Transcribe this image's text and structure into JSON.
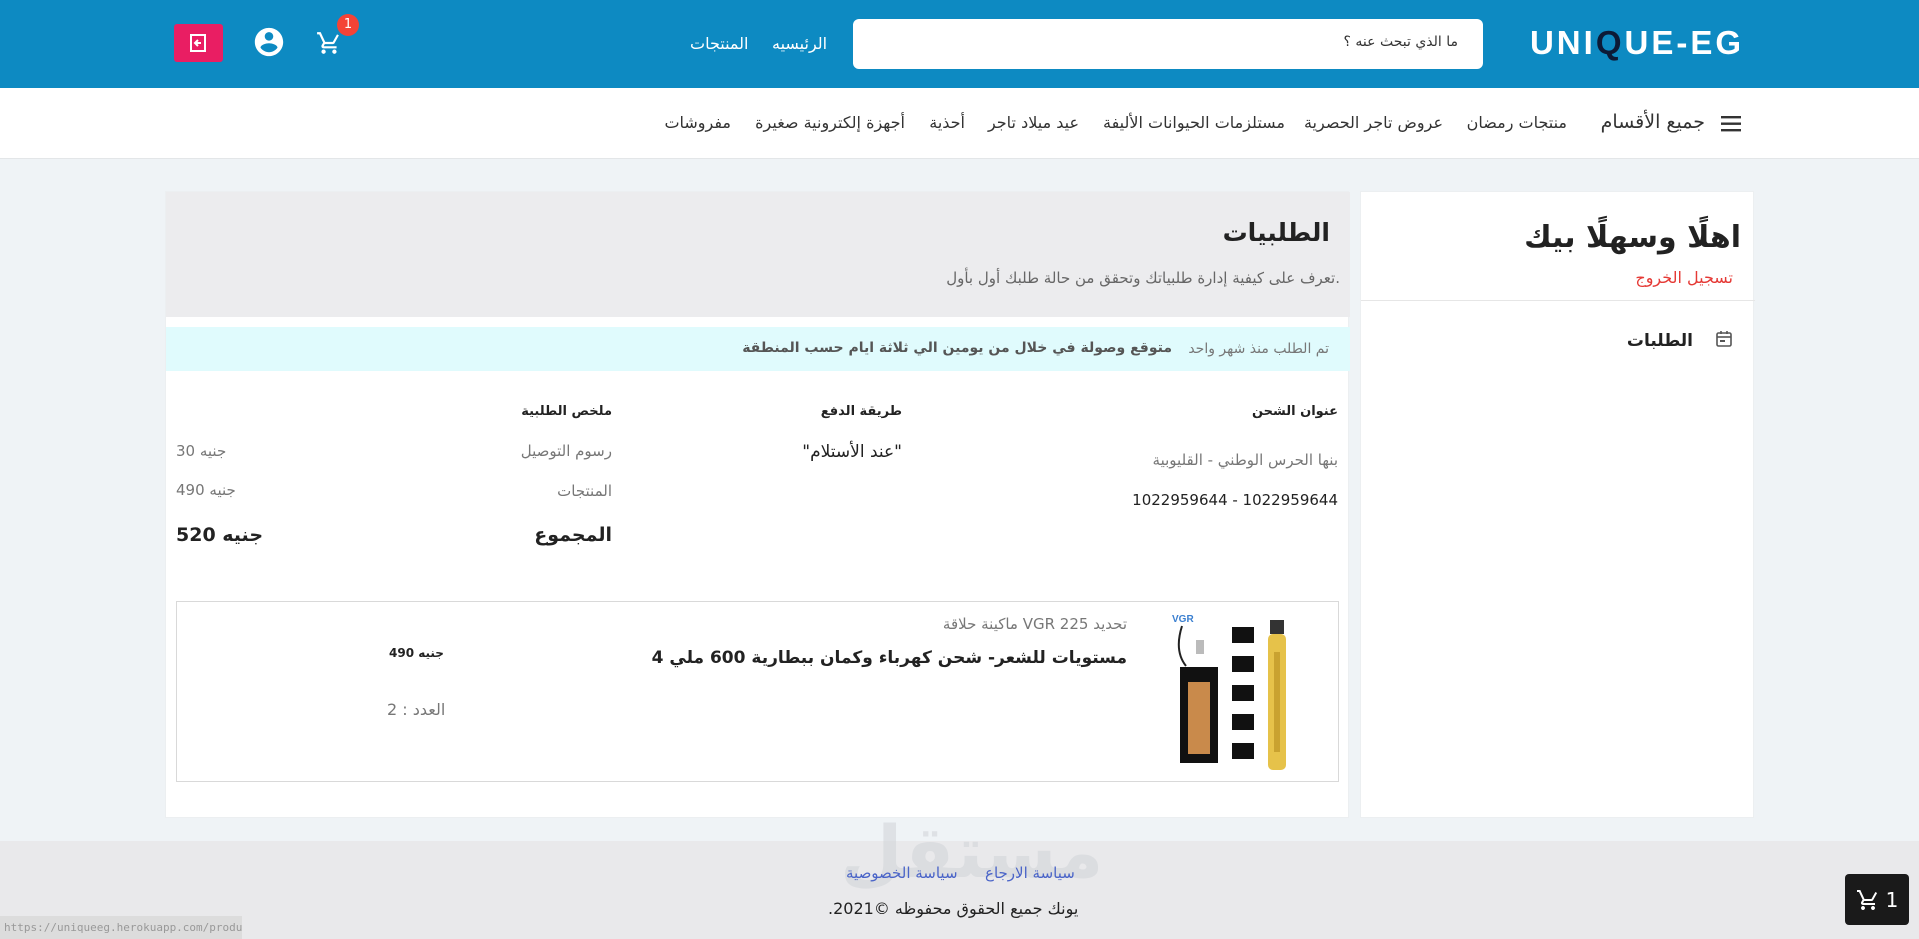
{
  "header": {
    "logo_pre": "UNI",
    "logo_q": "Q",
    "logo_post": "UE-EG",
    "search_placeholder": "ما الذي تبحث عنه ؟",
    "nav_home": "الرئيسيه",
    "nav_products": "المنتجات",
    "cart_count": "1"
  },
  "categories": {
    "all": "جميع الأقسام",
    "items": [
      "منتجات رمضان",
      "عروض تاجر الحصرية",
      "مستلزمات الحيوانات الأليفة",
      "عيد ميلاد تاجر",
      "أحذية",
      "أجهزة إلكترونية صغيرة",
      "مفروشات"
    ]
  },
  "sidebar": {
    "welcome": "اهلًا وسهلًا بيك",
    "logout": "تسجيل الخروج",
    "orders": "الطلبات"
  },
  "orders": {
    "title": "الطلبيات",
    "subtitle": "تعرف على كيفية إدارة طلبياتك وتحقق من حالة طلبك أول بأول.",
    "notice_date": "تم الطلب منذ شهر واحد",
    "notice_eta": "متوقع وصولة في خلال من يومين الي ثلاثة ايام حسب المنطقة",
    "shipping_label": "عنوان الشحن",
    "shipping_address": "بنها الحرس الوطني - القليوبية",
    "shipping_phone": "1022959644 - 1022959644",
    "payment_label": "طريقة الدفع",
    "payment_value": "\"عند الأستلام\"",
    "summary_label": "ملخص الطلبية",
    "delivery_label": "رسوم التوصيل",
    "delivery_value": "30 جنيه",
    "products_label": "المنتجات",
    "products_value": "490 جنيه",
    "total_label": "المجموع",
    "total_value": "520 جنيه"
  },
  "item": {
    "subtitle": "ماكينة حلاقة VGR 225 تحديد",
    "name": "4 مستويات للشعر- شحن كهرباء وكمان ببطارية 600 ملي",
    "price": "490 جنيه",
    "quantity": "العدد : 2",
    "brand": "VGR"
  },
  "footer": {
    "return_policy": "سياسة الارجاع",
    "privacy_policy": "سياسة الخصوصية",
    "copyright": ".يونك جميع الحقوق محفوظه ©2021",
    "watermark": "مستقل",
    "status_url": "https://uniqueeg.herokuapp.com/products"
  },
  "float_cart": {
    "count": "1"
  },
  "colors": {
    "topbar": "#0d8ac2",
    "accent": "#e91e63",
    "badge": "#f44336",
    "notice": "#e0fbfd"
  }
}
